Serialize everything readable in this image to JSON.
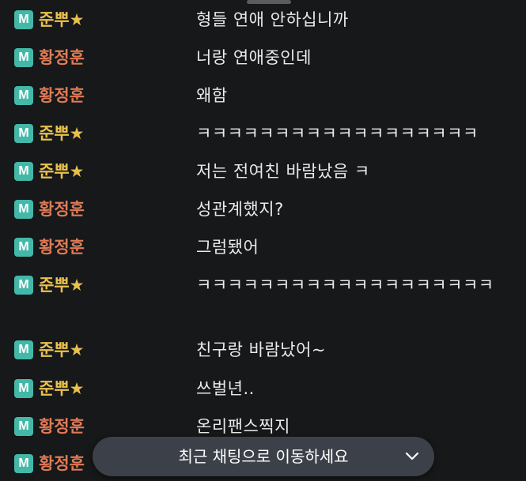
{
  "colors": {
    "background": "#161819",
    "badge": "#44b8a8",
    "nick_junppu": "#e8c04e",
    "nick_hwang": "#e07a55",
    "message_text": "#e9eaeb",
    "jump_bar": "#3c4149"
  },
  "messages": [
    {
      "badge": "M",
      "nick": "준뿌★",
      "text": "형들 연애 안하십니까"
    },
    {
      "badge": "M",
      "nick": "황정훈",
      "text": "너랑 연애중인데"
    },
    {
      "badge": "M",
      "nick": "황정훈",
      "text": "왜함"
    },
    {
      "badge": "M",
      "nick": "준뿌★",
      "text": "ㅋㅋㅋㅋㅋㅋㅋㅋㅋㅋㅋㅋㅋㅋㅋㅋㅋㅋ"
    },
    {
      "badge": "M",
      "nick": "준뿌★",
      "text": "저는 전여친 바람났음 ㅋ"
    },
    {
      "badge": "M",
      "nick": "황정훈",
      "text": "성관계했지?"
    },
    {
      "badge": "M",
      "nick": "황정훈",
      "text": "그럼됐어"
    },
    {
      "badge": "M",
      "nick": "준뿌★",
      "text": "ㅋㅋㅋㅋㅋㅋㅋㅋㅋㅋㅋㅋㅋㅋㅋㅋㅋㅋㅋ"
    },
    {
      "badge": "M",
      "nick": "준뿌★",
      "text": "친구랑 바람났어~"
    },
    {
      "badge": "M",
      "nick": "준뿌★",
      "text": "쓰벌년.."
    },
    {
      "badge": "M",
      "nick": "황정훈",
      "text": "온리팬스찍지"
    },
    {
      "badge": "M",
      "nick": "황정훈",
      "text": ""
    }
  ],
  "jump_bar": {
    "label": "최근 채팅으로 이동하세요",
    "icon": "chevron-down-icon"
  }
}
